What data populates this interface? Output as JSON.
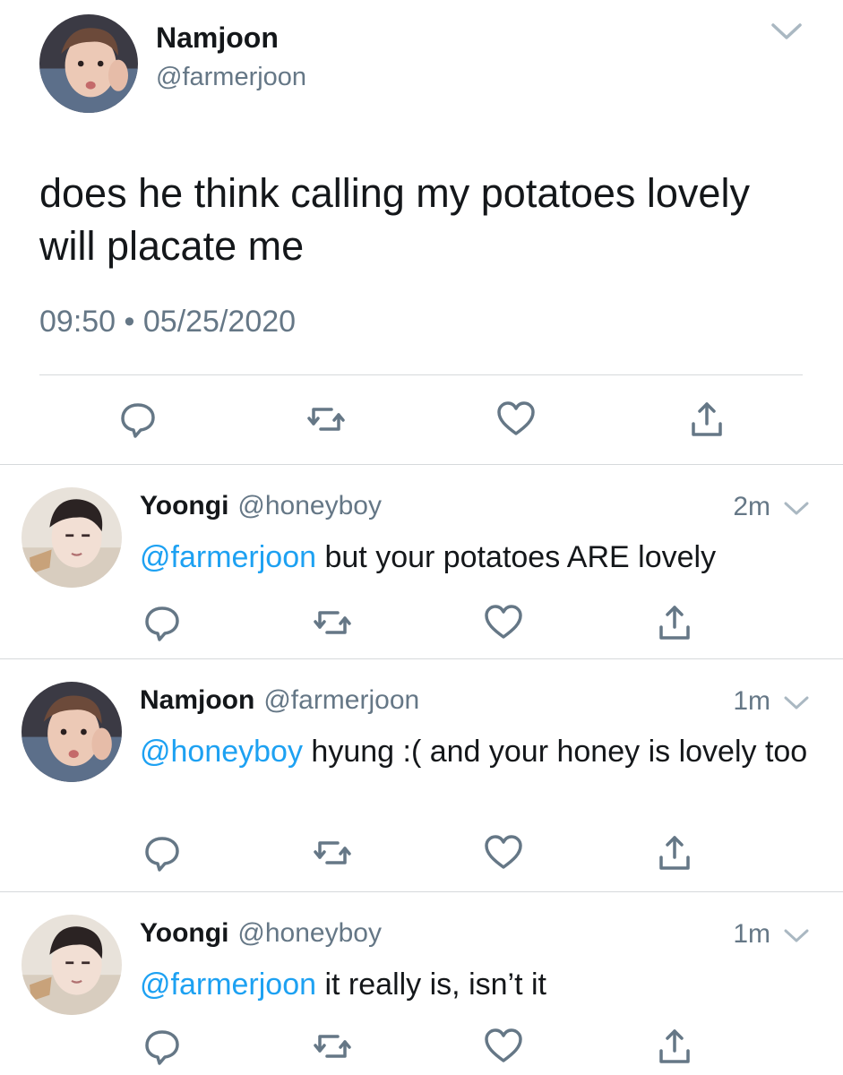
{
  "main_tweet": {
    "name": "Namjoon",
    "handle": "@farmerjoon",
    "text": "does he think calling my potatoes lovely will placate me",
    "timestamp": "09:50 • 05/25/2020"
  },
  "replies": [
    {
      "name": "Yoongi",
      "handle": "@honeyboy",
      "time": "2m",
      "mention": "@farmerjoon",
      "text": " but your potatoes ARE lovely"
    },
    {
      "name": "Namjoon",
      "handle": "@farmerjoon",
      "time": "1m",
      "mention": "@honeyboy",
      "text": " hyung :( and your honey is lovely too"
    },
    {
      "name": "Yoongi",
      "handle": "@honeyboy",
      "time": "1m",
      "mention": "@farmerjoon",
      "text": " it really is, isn’t it"
    }
  ],
  "icons": {
    "reply": "speech-bubble-icon",
    "retweet": "retweet-icon",
    "like": "heart-icon",
    "share": "share-icon",
    "menu": "chevron-down-icon"
  },
  "colors": {
    "mention": "#1da1f2",
    "secondary_text": "#657786",
    "icon": "#657786",
    "divider": "#d6d9db"
  }
}
